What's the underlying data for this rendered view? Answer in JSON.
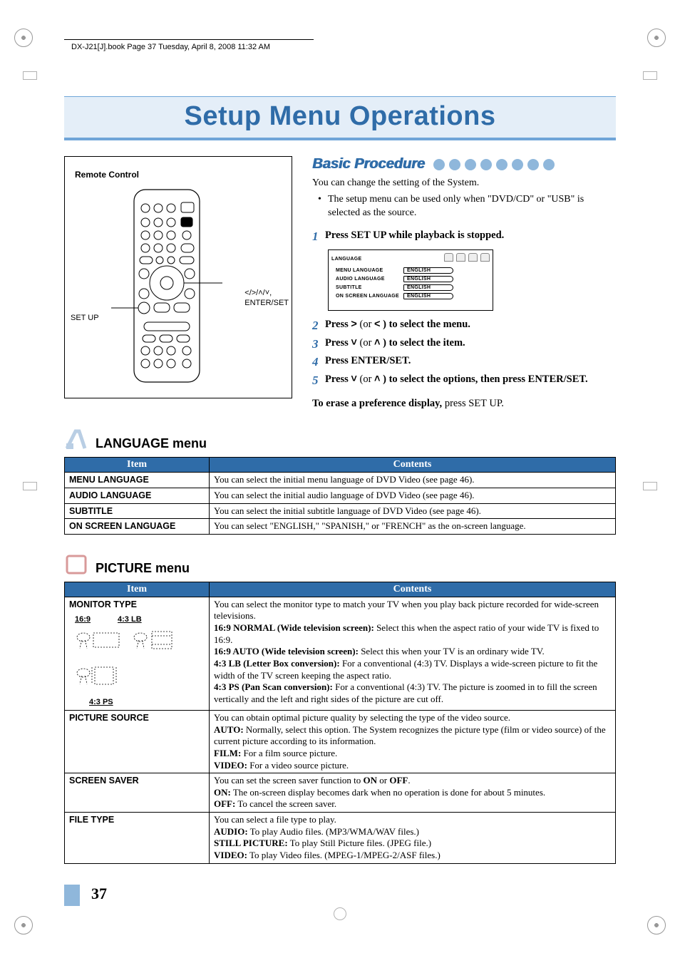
{
  "headerMeta": "DX-J21[J].book  Page 37  Tuesday, April 8, 2008  11:32 AM",
  "title": "Setup Menu Operations",
  "remote": {
    "boxTitle": "Remote Control",
    "labelSetup": "SET UP",
    "labelNav1": "</>/˄/˅,",
    "labelNav2": "ENTER/SET"
  },
  "basic": {
    "heading": "Basic Procedure",
    "intro": "You can change the setting of the System.",
    "bullet": "The setup menu can be used only when \"DVD/CD\" or \"USB\" is selected as the source.",
    "steps": [
      {
        "n": "1",
        "text": "Press SET UP while playback is stopped."
      },
      {
        "n": "2",
        "prefix": "Press ",
        "sym1": ">",
        "mid": " (or ",
        "sym2": "<",
        "suffix": " ) to select the menu."
      },
      {
        "n": "3",
        "prefix": "Press ",
        "sym1": "˅",
        "mid": " (or ",
        "sym2": "˄",
        "suffix": " ) to select the item."
      },
      {
        "n": "4",
        "text": "Press ENTER/SET."
      },
      {
        "n": "5",
        "prefix": "Press ",
        "sym1": "˅",
        "mid": " (or ",
        "sym2": "˄",
        "suffix": " ) to select the options, then press ENTER/SET."
      }
    ],
    "eraseBold": "To erase a preference display,",
    "eraseRest": " press SET UP.",
    "osd": {
      "tab": "LANGUAGE",
      "rows": [
        {
          "item": "MENU LANGUAGE",
          "val": "ENGLISH"
        },
        {
          "item": "AUDIO LANGUAGE",
          "val": "ENGLISH"
        },
        {
          "item": "SUBTITLE",
          "val": "ENGLISH"
        },
        {
          "item": "ON SCREEN LANGUAGE",
          "val": "ENGLISH"
        }
      ]
    }
  },
  "languageMenu": {
    "heading": "LANGUAGE menu",
    "headers": {
      "item": "Item",
      "contents": "Contents"
    },
    "rows": [
      {
        "item": "MENU LANGUAGE",
        "contents": "You can select the initial menu language of DVD Video (see page 46)."
      },
      {
        "item": "AUDIO LANGUAGE",
        "contents": "You can select the initial audio language of DVD Video (see page 46)."
      },
      {
        "item": "SUBTITLE",
        "contents": "You can select the initial subtitle language of DVD Video (see page 46)."
      },
      {
        "item": "ON SCREEN LANGUAGE",
        "contents": "You can select \"ENGLISH,\" \"SPANISH,\" or \"FRENCH\" as the on-screen language."
      }
    ]
  },
  "pictureMenu": {
    "heading": "PICTURE menu",
    "headers": {
      "item": "Item",
      "contents": "Contents"
    },
    "rows": [
      {
        "item": "MONITOR TYPE",
        "subs": {
          "a": "16:9",
          "b": "4:3 LB",
          "c": "4:3 PS"
        },
        "contents": {
          "lead": "You can select the monitor type to match your TV when you play back picture recorded for wide-screen televisions.",
          "o1b": "16:9 NORMAL (Wide television screen):",
          "o1": " Select this when the aspect ratio of your wide TV is fixed to 16:9.",
          "o2b": "16:9 AUTO (Wide television screen):",
          "o2": " Select this when your TV is an ordinary wide TV.",
          "o3b": "4:3 LB (Letter Box conversion):",
          "o3": " For a conventional (4:3) TV. Displays a wide-screen picture to fit the width of the TV screen keeping the aspect ratio.",
          "o4b": "4:3 PS (Pan Scan conversion):",
          "o4": " For a conventional (4:3) TV. The picture is zoomed in to fill the screen vertically and the left and right sides of the picture are cut off."
        }
      },
      {
        "item": "PICTURE SOURCE",
        "contents": {
          "lead": "You can obtain optimal picture quality by selecting the type of the video source.",
          "o1b": "AUTO:",
          "o1": " Normally, select this option. The System recognizes the picture type (film or video source) of the current picture according to its information.",
          "o2b": "FILM:",
          "o2": " For a film source picture.",
          "o3b": "VIDEO:",
          "o3": " For a video source picture."
        }
      },
      {
        "item": "SCREEN SAVER",
        "contents": {
          "lead1": "You can set the screen saver function to ",
          "leadB1": "ON",
          "leadMid": " or ",
          "leadB2": "OFF",
          "leadEnd": ".",
          "o1b": "ON:",
          "o1": " The on-screen display becomes dark when no operation is done for about 5 minutes.",
          "o2b": "OFF:",
          "o2": " To cancel the screen saver."
        }
      },
      {
        "item": "FILE TYPE",
        "contents": {
          "lead": "You can select a file type to play.",
          "o1b": "AUDIO:",
          "o1": " To play Audio files. (MP3/WMA/WAV files.)",
          "o2b": "STILL PICTURE:",
          "o2": " To play Still Picture files. (JPEG file.)",
          "o3b": "VIDEO:",
          "o3": " To play Video files. (MPEG-1/MPEG-2/ASF files.)"
        }
      }
    ]
  },
  "pageNumber": "37"
}
